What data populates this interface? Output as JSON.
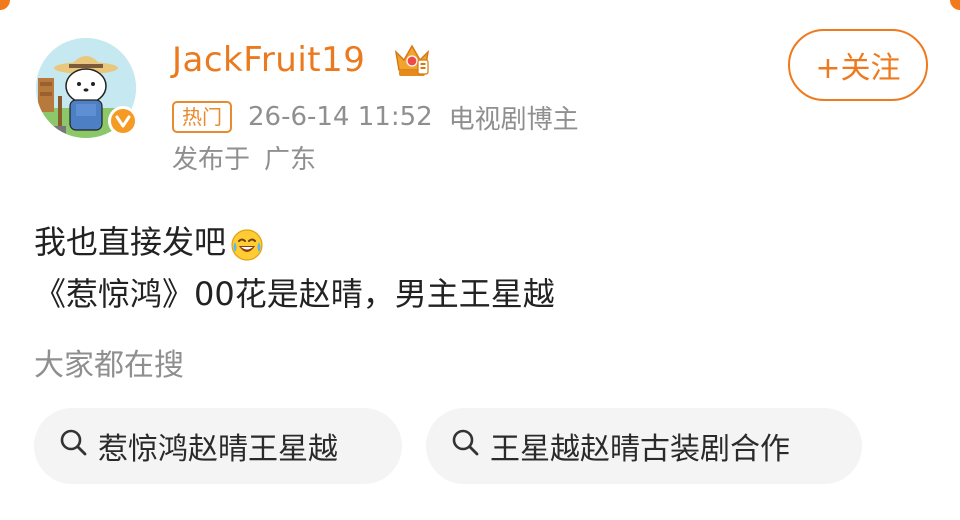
{
  "post": {
    "username": "JackFruit19",
    "hot_tag": "热门",
    "timestamp": "26-6-14 11:52",
    "role": "电视剧博主",
    "location_label": "发布于",
    "location": "广东",
    "follow_label": "+关注",
    "text_line_1": "我也直接发吧",
    "text_line_2": "《惹惊鸿》00花是赵晴，男主王星越"
  },
  "search": {
    "title": "大家都在搜",
    "items": [
      {
        "label": "惹惊鸿赵晴王星越",
        "icon": "search-icon"
      },
      {
        "label": "王星越赵晴古装剧合作",
        "icon": "search-icon"
      }
    ]
  },
  "theme": {
    "accent": "#eb7a1e",
    "muted_text": "#8f8f8f",
    "chip_bg": "#f4f4f4"
  }
}
